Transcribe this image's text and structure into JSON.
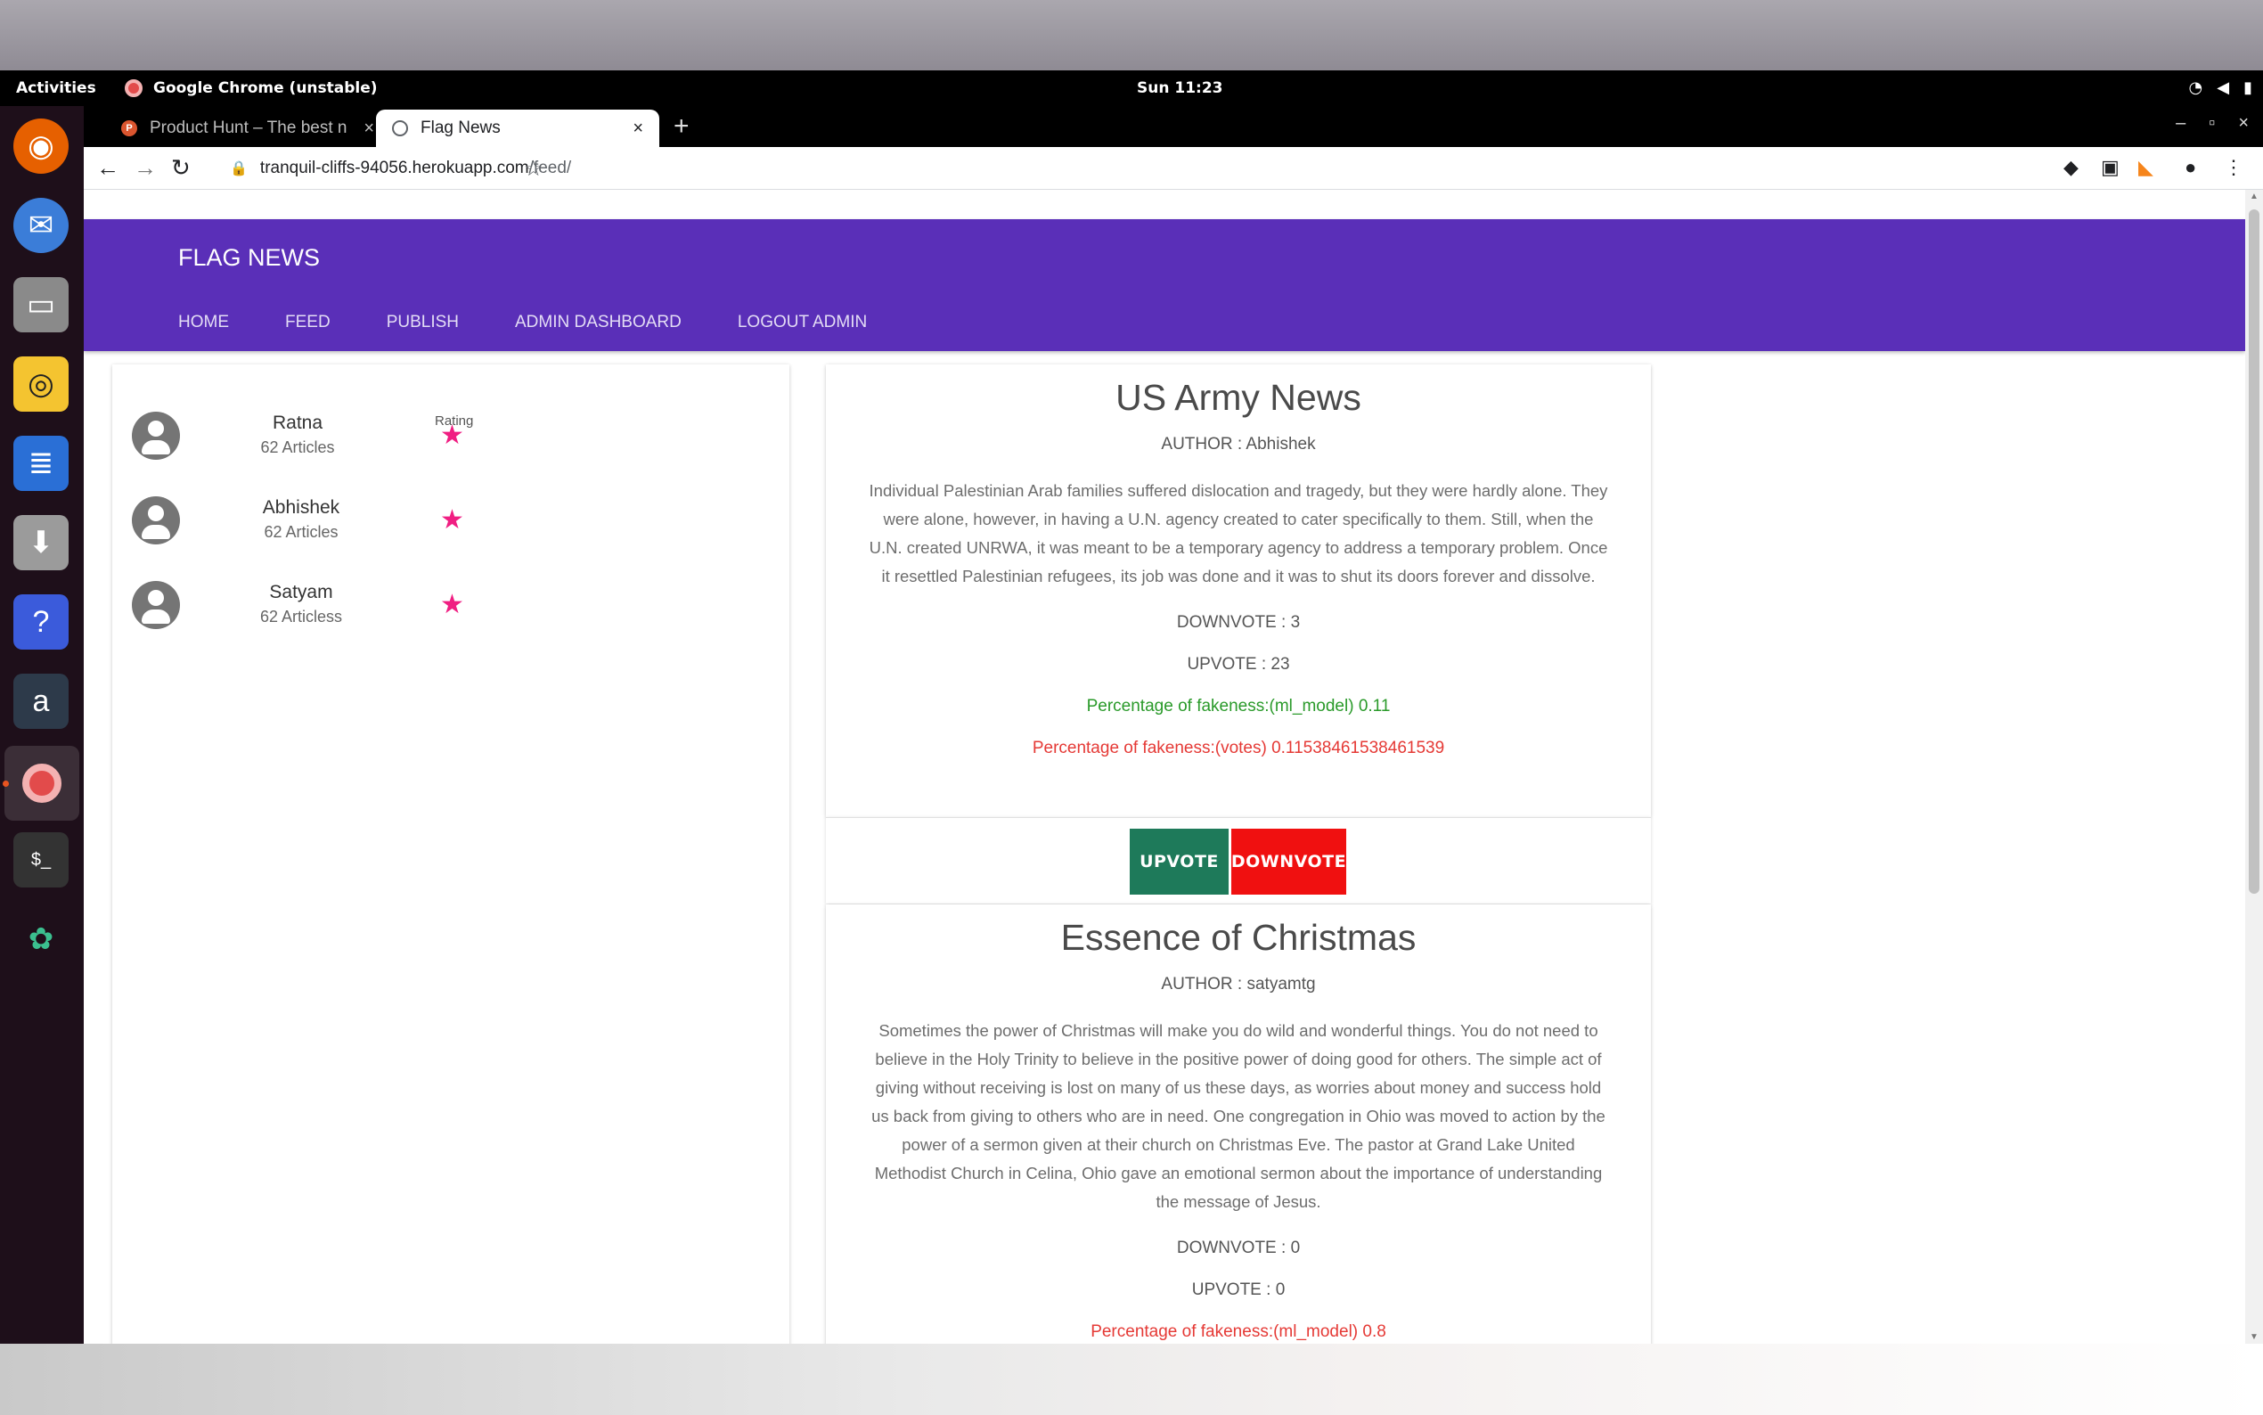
{
  "desktop": {
    "activities": "Activities",
    "app_name": "Google Chrome (unstable)",
    "clock": "Sun 11:23"
  },
  "browser": {
    "tabs": [
      {
        "title": "Product Hunt – The best n",
        "favicon": "P",
        "favicon_color": "#da552f"
      },
      {
        "title": "Flag News",
        "favicon": "",
        "favicon_color": "#5f6368"
      }
    ],
    "url_host": "tranquil-cliffs-94056.herokuapp.com",
    "url_path": "/feed/"
  },
  "site": {
    "brand": "FLAG NEWS",
    "nav": [
      "HOME",
      "FEED",
      "PUBLISH",
      "ADMIN DASHBOARD",
      "LOGOUT ADMIN"
    ],
    "accent_color": "#5a2fb8"
  },
  "authors": {
    "rating_label": "Rating",
    "list": [
      {
        "name": "Ratna",
        "count": "62 Articles"
      },
      {
        "name": "Abhishek",
        "count": "62 Articles"
      },
      {
        "name": "Satyam",
        "count": "62 Articless"
      }
    ]
  },
  "articles": [
    {
      "title": "US Army News",
      "author": "AUTHOR : Abhishek",
      "body": "Individual Palestinian Arab families suffered dislocation and tragedy, but they were hardly alone. They were alone, however, in having a U.N. agency created to cater specifically to them. Still, when the U.N. created UNRWA, it was meant to be a temporary agency to address a temporary problem. Once it resettled Palestinian refugees, its job was done and it was to shut its doors forever and dissolve.",
      "downvote": "DOWNVOTE : 3",
      "upvote": "UPVOTE : 23",
      "fake_ml": "Percentage of fakeness:(ml_model) 0.11",
      "fake_votes": "Percentage of fakeness:(votes) 0.11538461538461539"
    },
    {
      "title": "Essence of Christmas",
      "author": "AUTHOR : satyamtg",
      "body": "Sometimes the power of Christmas will make you do wild and wonderful things. You do not need to believe in the Holy Trinity to believe in the positive power of doing good for others. The simple act of giving without receiving is lost on many of us these days, as worries about money and success hold us back from giving to others who are in need. One congregation in Ohio was moved to action by the power of a sermon given at their church on Christmas Eve. The pastor at Grand Lake United Methodist Church in Celina, Ohio gave an emotional sermon about the importance of understanding the message of Jesus.",
      "downvote": "DOWNVOTE : 0",
      "upvote": "UPVOTE : 0",
      "fake_ml": "Percentage of fakeness:(ml_model) 0.8"
    }
  ],
  "buttons": {
    "upvote": "UPVOTE",
    "downvote": "DOWNVOTE"
  },
  "icons": {
    "star": "★",
    "back": "←",
    "forward": "→",
    "reload": "↻",
    "bookmark": "☆",
    "new_tab": "+",
    "close": "×"
  }
}
